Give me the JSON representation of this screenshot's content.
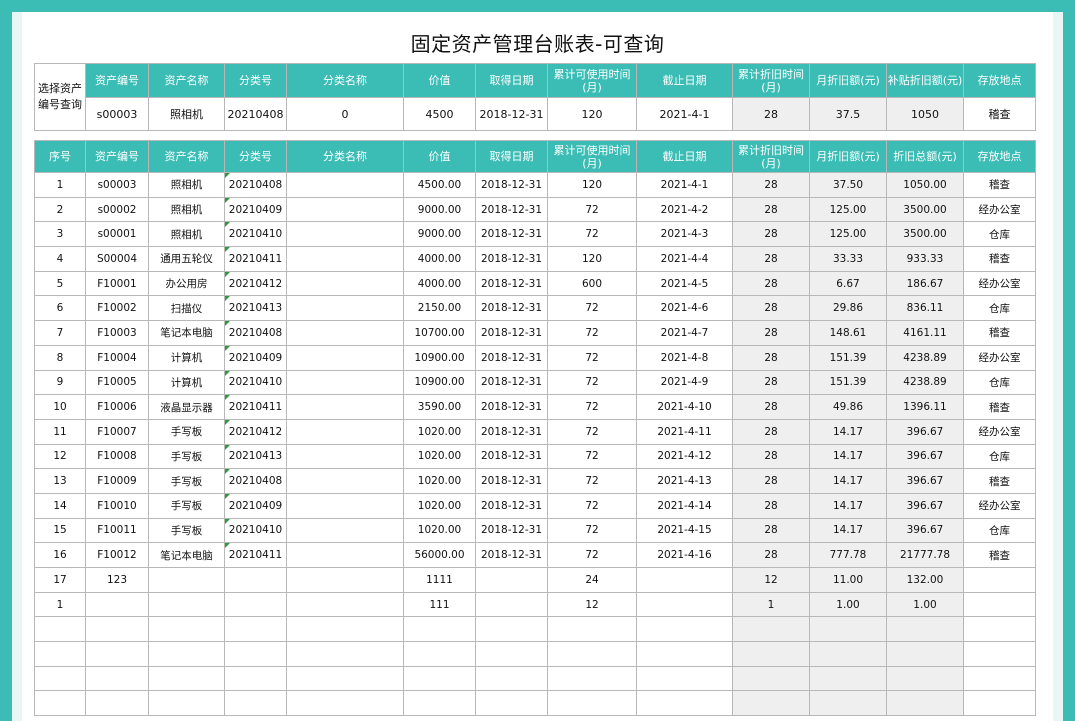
{
  "title": "固定资产管理台账表-可查询",
  "query": {
    "label": "选择资产编号查询",
    "headers": [
      "资产编号",
      "资产名称",
      "分类号",
      "分类名称",
      "价值",
      "取得日期",
      "累计可使用时间(月)",
      "截止日期",
      "累计折旧时间(月)",
      "月折旧额(元)",
      "补贴折旧额(元)",
      "存放地点"
    ],
    "values": [
      "s00003",
      "照相机",
      "20210408",
      "0",
      "4500",
      "2018-12-31",
      "120",
      "2021-4-1",
      "28",
      "37.5",
      "1050",
      "稽查"
    ]
  },
  "ledger": {
    "headers": [
      "序号",
      "资产编号",
      "资产名称",
      "分类号",
      "分类名称",
      "价值",
      "取得日期",
      "累计可使用时间(月)",
      "截止日期",
      "累计折旧时间(月)",
      "月折旧额(元)",
      "折旧总额(元)",
      "存放地点"
    ],
    "rows": [
      [
        "1",
        "s00003",
        "照相机",
        "20210408",
        "",
        "4500.00",
        "2018-12-31",
        "120",
        "2021-4-1",
        "28",
        "37.50",
        "1050.00",
        "稽查"
      ],
      [
        "2",
        "s00002",
        "照相机",
        "20210409",
        "",
        "9000.00",
        "2018-12-31",
        "72",
        "2021-4-2",
        "28",
        "125.00",
        "3500.00",
        "经办公室"
      ],
      [
        "3",
        "s00001",
        "照相机",
        "20210410",
        "",
        "9000.00",
        "2018-12-31",
        "72",
        "2021-4-3",
        "28",
        "125.00",
        "3500.00",
        "仓库"
      ],
      [
        "4",
        "S00004",
        "通用五轮仪",
        "20210411",
        "",
        "4000.00",
        "2018-12-31",
        "120",
        "2021-4-4",
        "28",
        "33.33",
        "933.33",
        "稽查"
      ],
      [
        "5",
        "F10001",
        "办公用房",
        "20210412",
        "",
        "4000.00",
        "2018-12-31",
        "600",
        "2021-4-5",
        "28",
        "6.67",
        "186.67",
        "经办公室"
      ],
      [
        "6",
        "F10002",
        "扫描仪",
        "20210413",
        "",
        "2150.00",
        "2018-12-31",
        "72",
        "2021-4-6",
        "28",
        "29.86",
        "836.11",
        "仓库"
      ],
      [
        "7",
        "F10003",
        "笔记本电脑",
        "20210408",
        "",
        "10700.00",
        "2018-12-31",
        "72",
        "2021-4-7",
        "28",
        "148.61",
        "4161.11",
        "稽查"
      ],
      [
        "8",
        "F10004",
        "计算机",
        "20210409",
        "",
        "10900.00",
        "2018-12-31",
        "72",
        "2021-4-8",
        "28",
        "151.39",
        "4238.89",
        "经办公室"
      ],
      [
        "9",
        "F10005",
        "计算机",
        "20210410",
        "",
        "10900.00",
        "2018-12-31",
        "72",
        "2021-4-9",
        "28",
        "151.39",
        "4238.89",
        "仓库"
      ],
      [
        "10",
        "F10006",
        "液晶显示器",
        "20210411",
        "",
        "3590.00",
        "2018-12-31",
        "72",
        "2021-4-10",
        "28",
        "49.86",
        "1396.11",
        "稽查"
      ],
      [
        "11",
        "F10007",
        "手写板",
        "20210412",
        "",
        "1020.00",
        "2018-12-31",
        "72",
        "2021-4-11",
        "28",
        "14.17",
        "396.67",
        "经办公室"
      ],
      [
        "12",
        "F10008",
        "手写板",
        "20210413",
        "",
        "1020.00",
        "2018-12-31",
        "72",
        "2021-4-12",
        "28",
        "14.17",
        "396.67",
        "仓库"
      ],
      [
        "13",
        "F10009",
        "手写板",
        "20210408",
        "",
        "1020.00",
        "2018-12-31",
        "72",
        "2021-4-13",
        "28",
        "14.17",
        "396.67",
        "稽查"
      ],
      [
        "14",
        "F10010",
        "手写板",
        "20210409",
        "",
        "1020.00",
        "2018-12-31",
        "72",
        "2021-4-14",
        "28",
        "14.17",
        "396.67",
        "经办公室"
      ],
      [
        "15",
        "F10011",
        "手写板",
        "20210410",
        "",
        "1020.00",
        "2018-12-31",
        "72",
        "2021-4-15",
        "28",
        "14.17",
        "396.67",
        "仓库"
      ],
      [
        "16",
        "F10012",
        "笔记本电脑",
        "20210411",
        "",
        "56000.00",
        "2018-12-31",
        "72",
        "2021-4-16",
        "28",
        "777.78",
        "21777.78",
        "稽查"
      ],
      [
        "17",
        "123",
        "",
        "",
        "",
        "1111",
        "",
        "24",
        "",
        "12",
        "11.00",
        "132.00",
        ""
      ],
      [
        "1",
        "",
        "",
        "",
        "",
        "111",
        "",
        "12",
        "",
        "1",
        "1.00",
        "1.00",
        ""
      ],
      [
        "",
        "",
        "",
        "",
        "",
        "",
        "",
        "",
        "",
        "",
        "",
        "",
        ""
      ],
      [
        "",
        "",
        "",
        "",
        "",
        "",
        "",
        "",
        "",
        "",
        "",
        "",
        ""
      ],
      [
        "",
        "",
        "",
        "",
        "",
        "",
        "",
        "",
        "",
        "",
        "",
        "",
        ""
      ],
      [
        "",
        "",
        "",
        "",
        "",
        "",
        "",
        "",
        "",
        "",
        "",
        "",
        ""
      ]
    ]
  }
}
